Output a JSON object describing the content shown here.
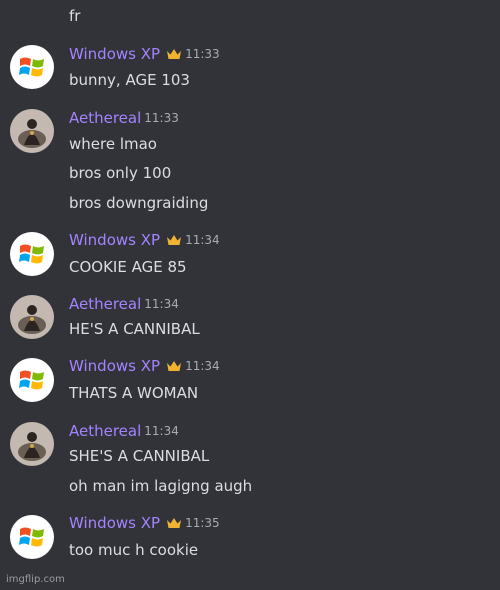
{
  "leading_message": "fr",
  "messages": [
    {
      "author": "Windows XP",
      "time": "11:33",
      "crown": true,
      "avatar_icon": "windows-xp-logo-icon",
      "lines": [
        "bunny, AGE 103"
      ]
    },
    {
      "author": "Aethereal",
      "time": "11:33",
      "crown": false,
      "avatar_icon": "dark-figure-avatar-icon",
      "lines": [
        "where lmao",
        "bros only 100",
        "bros downgraiding"
      ]
    },
    {
      "author": "Windows XP",
      "time": "11:34",
      "crown": true,
      "avatar_icon": "windows-xp-logo-icon",
      "lines": [
        "COOKIE AGE 85"
      ]
    },
    {
      "author": "Aethereal",
      "time": "11:34",
      "crown": false,
      "avatar_icon": "dark-figure-avatar-icon",
      "lines": [
        "HE'S A CANNIBAL"
      ]
    },
    {
      "author": "Windows XP",
      "time": "11:34",
      "crown": true,
      "avatar_icon": "windows-xp-logo-icon",
      "lines": [
        "THATS A WOMAN"
      ]
    },
    {
      "author": "Aethereal",
      "time": "11:34",
      "crown": false,
      "avatar_icon": "dark-figure-avatar-icon",
      "lines": [
        "SHE'S A CANNIBAL",
        "oh man im lagigng augh"
      ]
    },
    {
      "author": "Windows XP",
      "time": "11:35",
      "crown": true,
      "avatar_icon": "windows-xp-logo-icon",
      "lines": [
        "too muc h cookie"
      ]
    }
  ],
  "watermark": "imgflip.com",
  "colors": {
    "background": "#313338",
    "username": "#a583ff",
    "text": "#dbdee1",
    "timestamp": "#a8abb2",
    "crown": "#f0b232"
  }
}
